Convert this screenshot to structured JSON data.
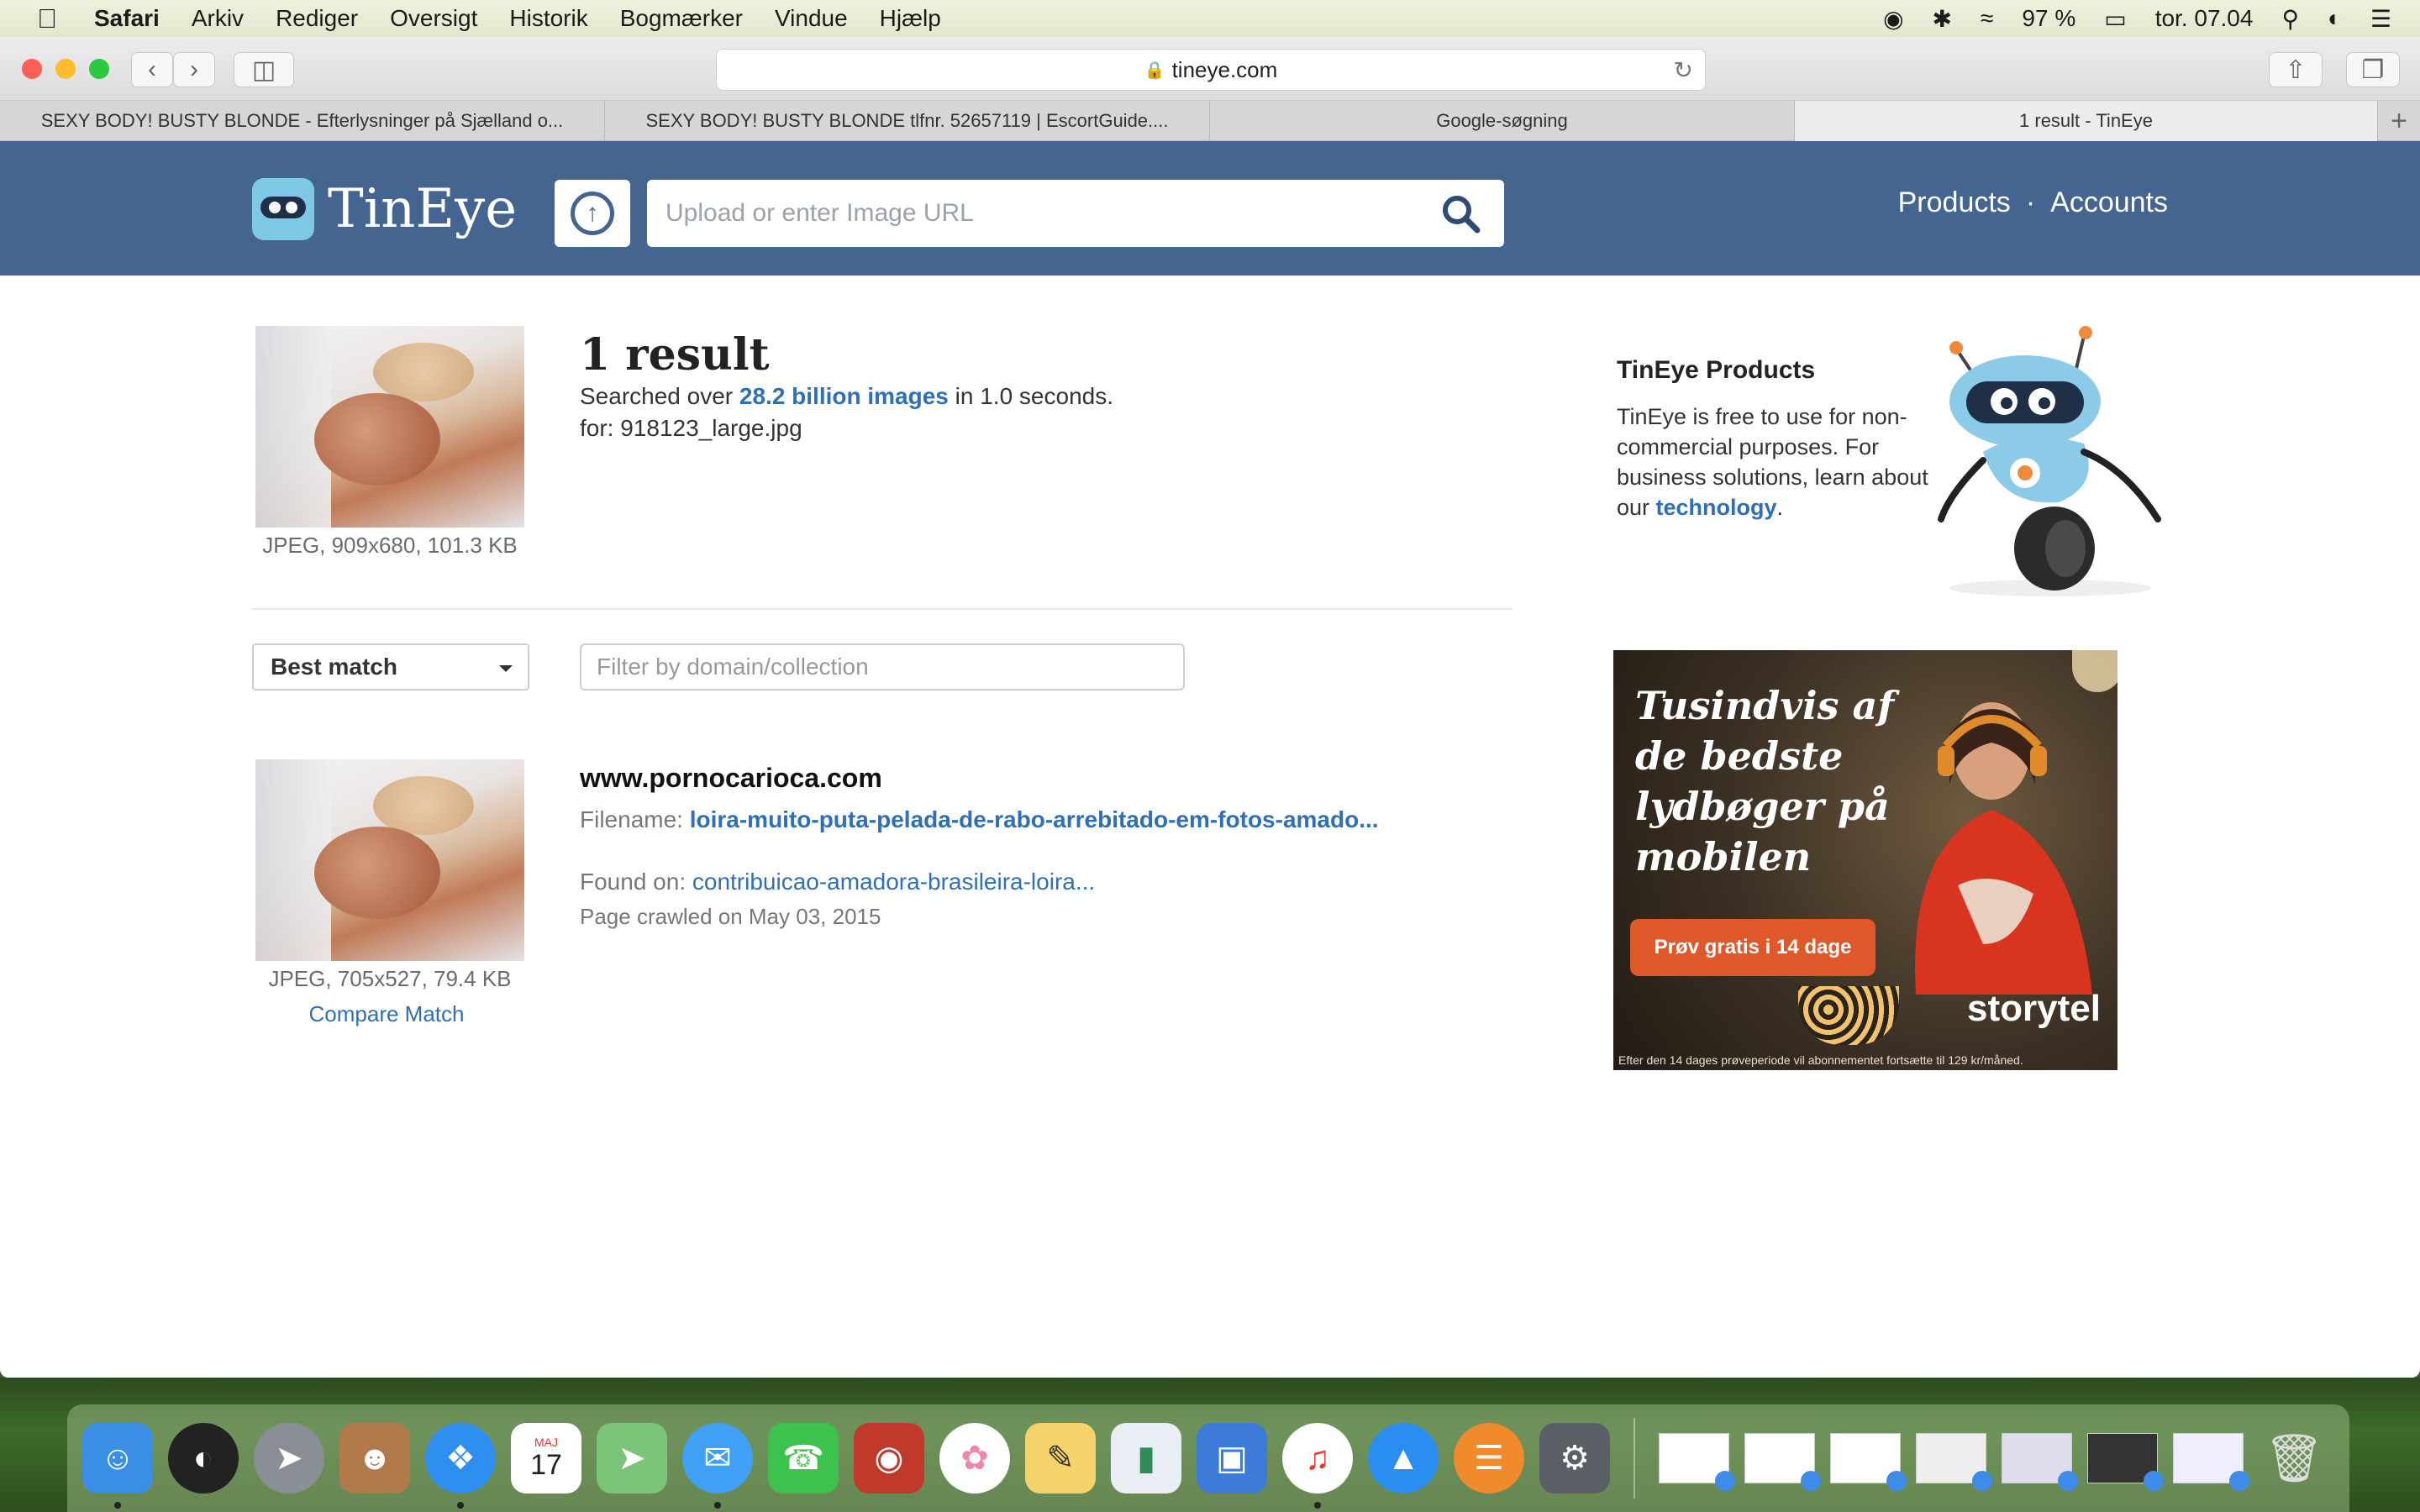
{
  "menubar": {
    "apple": "",
    "items": [
      "Safari",
      "Arkiv",
      "Rediger",
      "Oversigt",
      "Historik",
      "Bogmærker",
      "Vindue",
      "Hjælp"
    ],
    "battery": "97 %",
    "clock": "tor. 07.04"
  },
  "browser": {
    "address": "tineye.com",
    "tabs": [
      "SEXY BODY! BUSTY BLONDE - Efterlysninger på Sjælland o...",
      "SEXY BODY! BUSTY BLONDE tlfnr. 52657119 | EscortGuide....",
      "Google-søgning",
      "1 result - TinEye"
    ]
  },
  "header": {
    "logo_text": "TinEye",
    "search_placeholder": "Upload or enter Image URL",
    "nav": {
      "products": "Products",
      "separator": "·",
      "accounts": "Accounts"
    }
  },
  "query": {
    "meta": "JPEG, 909x680, 101.3 KB",
    "result_count": "1 result",
    "searched_prefix": "Searched over ",
    "searched_link": "28.2 billion images",
    "searched_suffix": " in 1.0 seconds.",
    "for_line": "for: 918123_large.jpg"
  },
  "controls": {
    "sort_label": "Best match",
    "filter_placeholder": "Filter by domain/collection"
  },
  "result": {
    "domain": "www.pornocarioca.com",
    "filename_label": "Filename: ",
    "filename_link": "loira-muito-puta-pelada-de-rabo-arrebitado-em-fotos-amado...",
    "found_label": "Found on: ",
    "found_link": "contribuicao-amadora-brasileira-loira...",
    "crawled": "Page crawled on May 03, 2015",
    "meta": "JPEG, 705x527, 79.4 KB",
    "compare": "Compare Match"
  },
  "sidebar": {
    "title": "TinEye Products",
    "text_before": "TinEye is free to use for non-commercial purposes. For business solutions, learn about our ",
    "link": "technology",
    "text_after": "."
  },
  "ad": {
    "headline": "Tusindvis af de bedste lydbøger på mobilen",
    "cta": "Prøv gratis i 14 dage",
    "brand": "storytel",
    "fine_print": "Efter den 14 dages prøveperiode vil abonnementet fortsætte til 129 kr/måned."
  },
  "dock": {
    "calendar_month": "MAJ",
    "calendar_day": "17"
  },
  "colors": {
    "header_bg": "#456591",
    "link": "#2f6fb5",
    "ad_cta": "#e0582a"
  }
}
